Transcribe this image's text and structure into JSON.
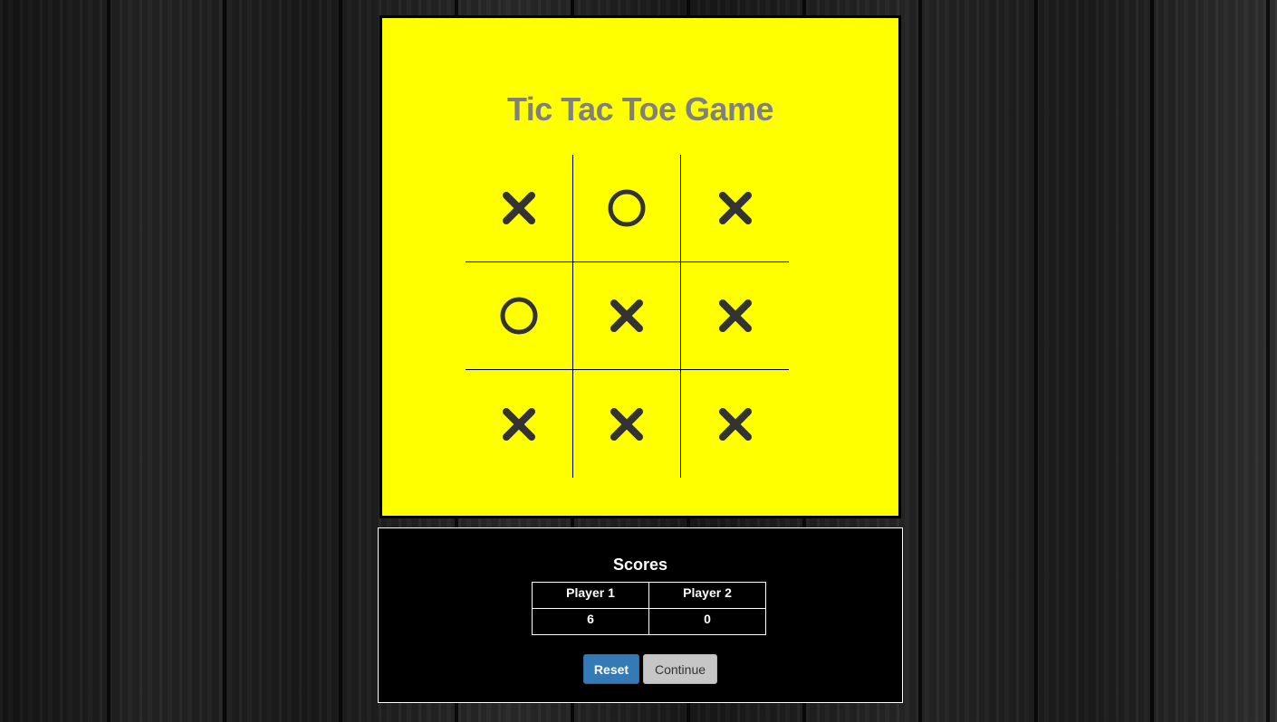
{
  "game": {
    "title": "Tic Tac Toe Game",
    "board": [
      "X",
      "O",
      "X",
      "O",
      "X",
      "X",
      "X",
      "X",
      "X"
    ],
    "colors": {
      "board_background": "#ffff00",
      "title": "#808080",
      "mark": "#333333"
    }
  },
  "scores": {
    "title": "Scores",
    "headers": [
      "Player 1",
      "Player 2"
    ],
    "values": [
      "6",
      "0"
    ]
  },
  "buttons": {
    "reset_label": "Reset",
    "continue_label": "Continue"
  }
}
